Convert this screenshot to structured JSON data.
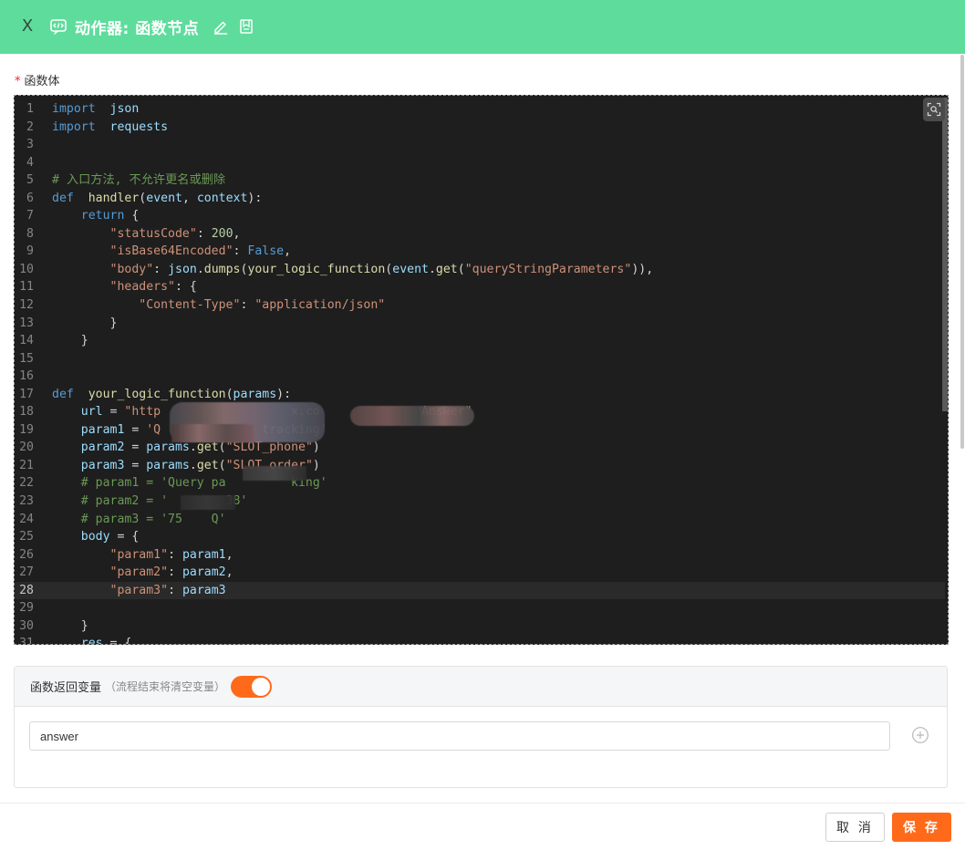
{
  "header": {
    "close_label": "X",
    "title": "动作器: 函数节点",
    "background_color": "#5edc9c"
  },
  "icons": {
    "node": "code-function-icon",
    "edit": "pencil-icon",
    "save_doc": "bookmark-doc-icon",
    "fullscreen": "fullscreen-search-icon",
    "add": "plus-circle-icon"
  },
  "editor": {
    "label": "函数体",
    "required_mark": "*",
    "active_line": 28,
    "lines": [
      {
        "n": "1",
        "t": [
          [
            "kw",
            "import"
          ],
          [
            "",
            "  "
          ],
          [
            "va",
            "json"
          ]
        ]
      },
      {
        "n": "2",
        "t": [
          [
            "kw",
            "import"
          ],
          [
            "",
            "  "
          ],
          [
            "va",
            "requests"
          ]
        ]
      },
      {
        "n": "3",
        "t": []
      },
      {
        "n": "4",
        "t": []
      },
      {
        "n": "5",
        "t": [
          [
            "cm",
            "# 入口方法, 不允许更名或删除"
          ]
        ]
      },
      {
        "n": "6",
        "t": [
          [
            "kw",
            "def"
          ],
          [
            "",
            "  "
          ],
          [
            "fn",
            "handler"
          ],
          [
            "",
            "("
          ],
          [
            "va",
            "event"
          ],
          [
            "",
            ", "
          ],
          [
            "va",
            "context"
          ],
          [
            "",
            "):"
          ]
        ]
      },
      {
        "n": "7",
        "t": [
          [
            "",
            "    "
          ],
          [
            "kw",
            "return"
          ],
          [
            "",
            " {"
          ]
        ]
      },
      {
        "n": "8",
        "t": [
          [
            "",
            "        "
          ],
          [
            "st",
            "\"statusCode\""
          ],
          [
            "",
            ": "
          ],
          [
            "nu",
            "200"
          ],
          [
            "",
            ","
          ]
        ]
      },
      {
        "n": "9",
        "t": [
          [
            "",
            "        "
          ],
          [
            "st",
            "\"isBase64Encoded\""
          ],
          [
            "",
            ": "
          ],
          [
            "kw",
            "False"
          ],
          [
            "",
            ","
          ]
        ]
      },
      {
        "n": "10",
        "t": [
          [
            "",
            "        "
          ],
          [
            "st",
            "\"body\""
          ],
          [
            "",
            ": "
          ],
          [
            "va",
            "json"
          ],
          [
            "",
            "."
          ],
          [
            "fn",
            "dumps"
          ],
          [
            "",
            "("
          ],
          [
            "fn",
            "your_logic_function"
          ],
          [
            "",
            "("
          ],
          [
            "va",
            "event"
          ],
          [
            "",
            "."
          ],
          [
            "fn",
            "get"
          ],
          [
            "",
            "("
          ],
          [
            "st",
            "\"queryStringParameters\""
          ],
          [
            "",
            ")),"
          ]
        ]
      },
      {
        "n": "11",
        "t": [
          [
            "",
            "        "
          ],
          [
            "st",
            "\"headers\""
          ],
          [
            "",
            ": {"
          ]
        ]
      },
      {
        "n": "12",
        "t": [
          [
            "",
            "            "
          ],
          [
            "st",
            "\"Content-Type\""
          ],
          [
            "",
            ": "
          ],
          [
            "st",
            "\"application/json\""
          ]
        ]
      },
      {
        "n": "13",
        "t": [
          [
            "",
            "        }"
          ]
        ]
      },
      {
        "n": "14",
        "t": [
          [
            "",
            "    }"
          ]
        ]
      },
      {
        "n": "15",
        "t": []
      },
      {
        "n": "16",
        "t": []
      },
      {
        "n": "17",
        "t": [
          [
            "kw",
            "def"
          ],
          [
            "",
            "  "
          ],
          [
            "fn",
            "your_logic_function"
          ],
          [
            "",
            "("
          ],
          [
            "va",
            "params"
          ],
          [
            "",
            "):"
          ]
        ]
      },
      {
        "n": "18",
        "t": [
          [
            "",
            "    "
          ],
          [
            "va",
            "url"
          ],
          [
            "",
            " = "
          ],
          [
            "st",
            "\"http                  x.co              Answer\""
          ]
        ]
      },
      {
        "n": "19",
        "t": [
          [
            "",
            "    "
          ],
          [
            "va",
            "param1"
          ],
          [
            "",
            " = "
          ],
          [
            "st",
            "'Q           el tracking'"
          ]
        ]
      },
      {
        "n": "20",
        "t": [
          [
            "",
            "    "
          ],
          [
            "va",
            "param2"
          ],
          [
            "",
            " = "
          ],
          [
            "va",
            "params"
          ],
          [
            "",
            "."
          ],
          [
            "fn",
            "get"
          ],
          [
            "",
            "("
          ],
          [
            "st",
            "\"SLOT_phone\""
          ],
          [
            "",
            ")"
          ]
        ]
      },
      {
        "n": "21",
        "t": [
          [
            "",
            "    "
          ],
          [
            "va",
            "param3"
          ],
          [
            "",
            " = "
          ],
          [
            "va",
            "params"
          ],
          [
            "",
            "."
          ],
          [
            "fn",
            "get"
          ],
          [
            "",
            "("
          ],
          [
            "st",
            "\"SLOT_order\""
          ],
          [
            "",
            ")"
          ]
        ]
      },
      {
        "n": "22",
        "t": [
          [
            "",
            "    "
          ],
          [
            "cm",
            "# param1 = 'Query pa         king'"
          ]
        ]
      },
      {
        "n": "23",
        "t": [
          [
            "",
            "    "
          ],
          [
            "cm",
            "# param2 = '        38'"
          ]
        ]
      },
      {
        "n": "24",
        "t": [
          [
            "",
            "    "
          ],
          [
            "cm",
            "# param3 = '75    Q'"
          ]
        ]
      },
      {
        "n": "25",
        "t": [
          [
            "",
            "    "
          ],
          [
            "va",
            "body"
          ],
          [
            "",
            " = {"
          ]
        ]
      },
      {
        "n": "26",
        "t": [
          [
            "",
            "        "
          ],
          [
            "st",
            "\"param1\""
          ],
          [
            "",
            ": "
          ],
          [
            "va",
            "param1"
          ],
          [
            "",
            ","
          ]
        ]
      },
      {
        "n": "27",
        "t": [
          [
            "",
            "        "
          ],
          [
            "st",
            "\"param2\""
          ],
          [
            "",
            ": "
          ],
          [
            "va",
            "param2"
          ],
          [
            "",
            ","
          ]
        ]
      },
      {
        "n": "28",
        "t": [
          [
            "",
            "        "
          ],
          [
            "st",
            "\"param3\""
          ],
          [
            "",
            ": "
          ],
          [
            "va",
            "param3"
          ]
        ]
      },
      {
        "n": "29",
        "t": []
      },
      {
        "n": "30",
        "t": [
          [
            "",
            "    }"
          ]
        ]
      },
      {
        "n": "31",
        "t": [
          [
            "",
            "    "
          ],
          [
            "va",
            "res"
          ],
          [
            "",
            " = {"
          ]
        ]
      }
    ]
  },
  "return_var": {
    "title": "函数返回变量",
    "hint": "（流程结束将清空变量）",
    "toggle_on": true,
    "toggle_color": "#ff6a1a",
    "value": "answer"
  },
  "footer": {
    "cancel_label": "取 消",
    "save_label": "保 存",
    "save_color": "#ff6a1a"
  }
}
